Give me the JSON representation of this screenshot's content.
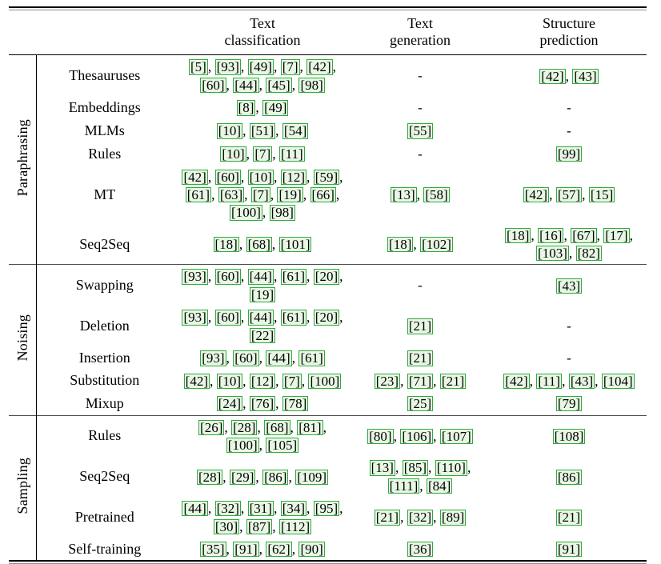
{
  "table": {
    "columns": {
      "group_header": "",
      "method_header": "",
      "text_classification": [
        "Text",
        "classification"
      ],
      "text_generation": [
        "Text",
        "generation"
      ],
      "structure_prediction": [
        "Structure",
        "prediction"
      ]
    },
    "empty_marker": "-",
    "sections": [
      {
        "group": "Paraphrasing",
        "rows": [
          {
            "method": "Thesauruses",
            "text_classification": [
              "5",
              "93",
              "49",
              "7",
              "42",
              "60",
              "44",
              "45",
              "98"
            ],
            "text_generation": [],
            "structure_prediction": [
              "42",
              "43"
            ]
          },
          {
            "method": "Embeddings",
            "text_classification": [
              "8",
              "49"
            ],
            "text_generation": [],
            "structure_prediction": []
          },
          {
            "method": "MLMs",
            "text_classification": [
              "10",
              "51",
              "54"
            ],
            "text_generation": [
              "55"
            ],
            "structure_prediction": []
          },
          {
            "method": "Rules",
            "text_classification": [
              "10",
              "7",
              "11"
            ],
            "text_generation": [],
            "structure_prediction": [
              "99"
            ]
          },
          {
            "method": "MT",
            "text_classification": [
              "42",
              "60",
              "10",
              "12",
              "59",
              "61",
              "63",
              "7",
              "19",
              "66",
              "100",
              "98"
            ],
            "text_generation": [
              "13",
              "58"
            ],
            "structure_prediction": [
              "42",
              "57",
              "15"
            ]
          },
          {
            "method": "Seq2Seq",
            "text_classification": [
              "18",
              "68",
              "101"
            ],
            "text_generation": [
              "18",
              "102"
            ],
            "structure_prediction": [
              "18",
              "16",
              "67",
              "17",
              "103",
              "82"
            ]
          }
        ]
      },
      {
        "group": "Noising",
        "rows": [
          {
            "method": "Swapping",
            "text_classification": [
              "93",
              "60",
              "44",
              "61",
              "20",
              "19"
            ],
            "text_generation": [],
            "structure_prediction": [
              "43"
            ]
          },
          {
            "method": "Deletion",
            "text_classification": [
              "93",
              "60",
              "44",
              "61",
              "20",
              "22"
            ],
            "text_generation": [
              "21"
            ],
            "structure_prediction": []
          },
          {
            "method": "Insertion",
            "text_classification": [
              "93",
              "60",
              "44",
              "61"
            ],
            "text_generation": [
              "21"
            ],
            "structure_prediction": []
          },
          {
            "method": "Substitution",
            "text_classification": [
              "42",
              "10",
              "12",
              "7",
              "100"
            ],
            "text_generation": [
              "23",
              "71",
              "21"
            ],
            "structure_prediction": [
              "42",
              "11",
              "43",
              "104"
            ]
          },
          {
            "method": "Mixup",
            "text_classification": [
              "24",
              "76",
              "78"
            ],
            "text_generation": [
              "25"
            ],
            "structure_prediction": [
              "79"
            ]
          }
        ]
      },
      {
        "group": "Sampling",
        "rows": [
          {
            "method": "Rules",
            "text_classification": [
              "26",
              "28",
              "68",
              "81",
              "100",
              "105"
            ],
            "text_generation": [
              "80",
              "106",
              "107"
            ],
            "structure_prediction": [
              "108"
            ]
          },
          {
            "method": "Seq2Seq",
            "text_classification": [
              "28",
              "29",
              "86",
              "109"
            ],
            "text_generation": [
              "13",
              "85",
              "110",
              "111",
              "84"
            ],
            "structure_prediction": [
              "86"
            ]
          },
          {
            "method": "Pretrained",
            "text_classification": [
              "44",
              "32",
              "31",
              "34",
              "95",
              "30",
              "87",
              "112"
            ],
            "text_generation": [
              "21",
              "32",
              "89"
            ],
            "structure_prediction": [
              "21"
            ]
          },
          {
            "method": "Self-training",
            "text_classification": [
              "35",
              "91",
              "62",
              "90"
            ],
            "text_generation": [
              "36"
            ],
            "structure_prediction": [
              "91"
            ]
          }
        ]
      }
    ]
  },
  "colors": {
    "cite_border": "#2eab3c",
    "cite_background": "#e8f7e4",
    "rule_dark": "#000000",
    "rule_light": "#8c8c8c",
    "text": "#000000"
  }
}
